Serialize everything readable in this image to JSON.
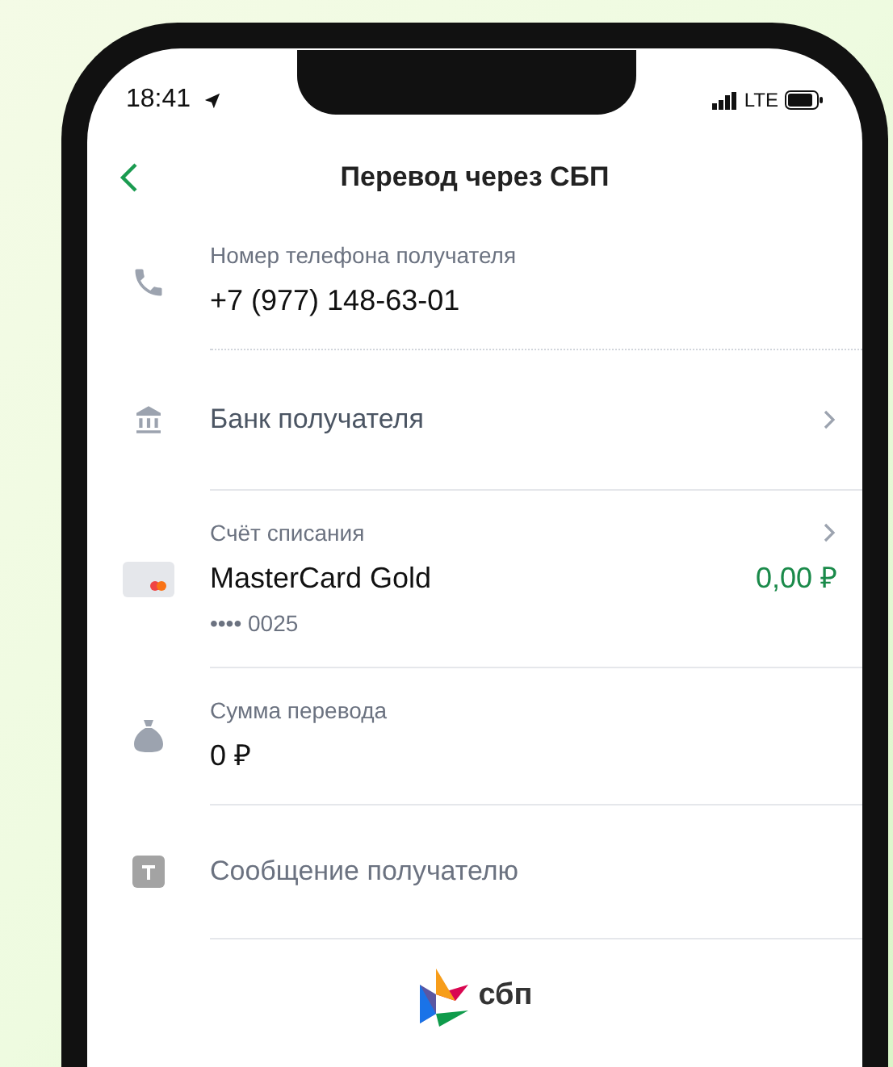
{
  "status_bar": {
    "time": "18:41",
    "network": "LTE"
  },
  "nav": {
    "title": "Перевод через СБП"
  },
  "rows": [
    {
      "kind": "field",
      "label": "Номер телефона получателя",
      "value": "+7 (977) 148-63-01"
    },
    {
      "kind": "link",
      "text": "Банк получателя"
    },
    {
      "kind": "account",
      "label": "Счёт списания",
      "value": "MasterCard Gold",
      "balance": "0,00 ₽",
      "number": "•••• 0025"
    },
    {
      "kind": "field",
      "label": "Сумма перевода",
      "value": "0 ₽"
    },
    {
      "kind": "placeholder",
      "text": "Сообщение получателю"
    }
  ],
  "logo": {
    "text": "сбп"
  }
}
